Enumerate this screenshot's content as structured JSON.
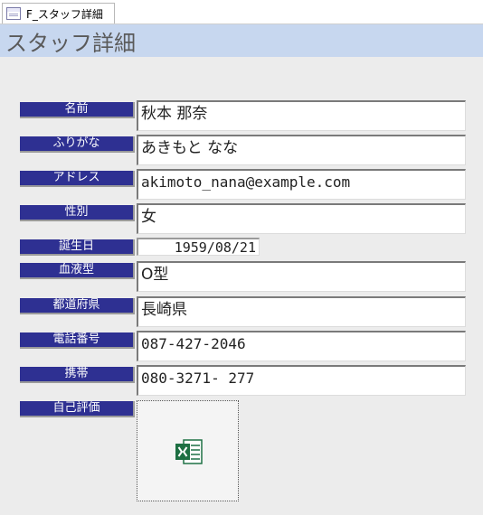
{
  "tab": {
    "label": "F_スタッフ詳細"
  },
  "header": {
    "title": "スタッフ詳細"
  },
  "fields": {
    "name": {
      "label": "名前",
      "value": "秋本 那奈"
    },
    "furigana": {
      "label": "ふりがな",
      "value": "あきもと なな"
    },
    "address": {
      "label": "アドレス",
      "value": "akimoto_nana@example.com"
    },
    "gender": {
      "label": "性別",
      "value": "女"
    },
    "birthday": {
      "label": "誕生日",
      "value": "1959/08/21"
    },
    "blood": {
      "label": "血液型",
      "value": "O型"
    },
    "prefecture": {
      "label": "都道府県",
      "value": "長崎県"
    },
    "phone": {
      "label": "電話番号",
      "value": "087-427-2046"
    },
    "mobile": {
      "label": "携帯",
      "value": "080-3271- 277"
    },
    "evaluation": {
      "label": "自己評価",
      "attachment_icon": "excel-file-icon"
    }
  },
  "colors": {
    "label_bg": "#2e3092",
    "header_bg": "#c7d7ef",
    "body_bg": "#ececec"
  }
}
